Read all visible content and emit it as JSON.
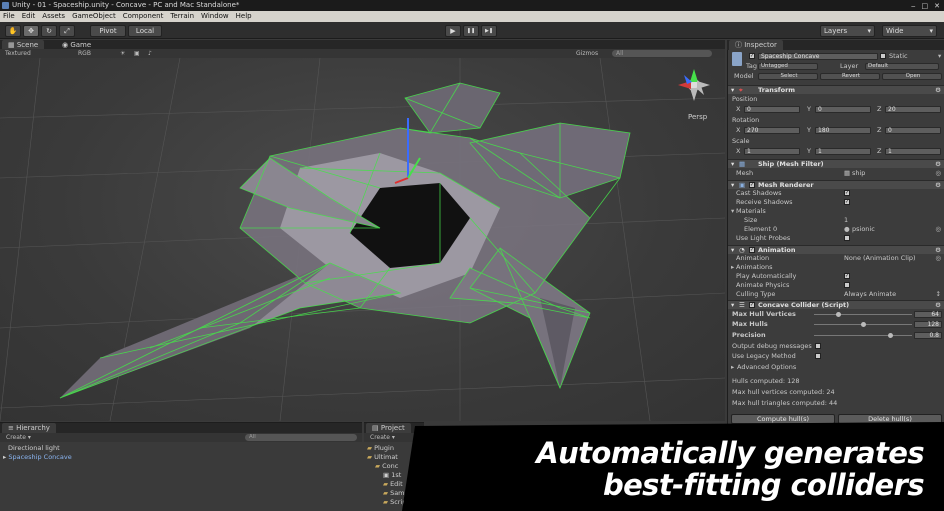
{
  "window": {
    "title": "Unity - 01 - Spaceship.unity - Concave - PC and Mac Standalone*"
  },
  "menu": [
    "File",
    "Edit",
    "Assets",
    "GameObject",
    "Component",
    "Terrain",
    "Window",
    "Help"
  ],
  "toolbar": {
    "pivot": "Pivot",
    "local": "Local",
    "play": "▶",
    "pause": "❚❚",
    "step": "▶❚",
    "layers": "Layers",
    "layout": "Wide"
  },
  "tabs": {
    "scene": "Scene",
    "game": "Game",
    "inspector": "Inspector",
    "hierarchy": "Hierarchy",
    "project": "Project"
  },
  "scene_bar": {
    "mode": "Textured",
    "channel": "RGB",
    "gizmos": "Gizmos",
    "search": "All"
  },
  "scene": {
    "projection": "Persp",
    "accent_color": "#46e04a"
  },
  "inspector": {
    "object_name": "Spaceship Concave",
    "static_label": "Static",
    "tag_label": "Tag",
    "tag_value": "Untagged",
    "layer_label": "Layer",
    "layer_value": "Default",
    "model_label": "Model",
    "model_buttons": [
      "Select",
      "Revert",
      "Open"
    ],
    "transform": {
      "title": "Transform",
      "position_label": "Position",
      "position": {
        "x": "0",
        "y": "0",
        "z": "20"
      },
      "rotation_label": "Rotation",
      "rotation": {
        "x": "270",
        "y": "180",
        "z": "0"
      },
      "scale_label": "Scale",
      "scale": {
        "x": "1",
        "y": "1",
        "z": "1"
      }
    },
    "mesh_filter": {
      "title": "Ship (Mesh Filter)",
      "mesh_label": "Mesh",
      "mesh_value": "ship"
    },
    "mesh_renderer": {
      "title": "Mesh Renderer",
      "cast_shadows": "Cast Shadows",
      "receive_shadows": "Receive Shadows",
      "materials": "Materials",
      "size_label": "Size",
      "size_value": "1",
      "element0_label": "Element 0",
      "element0_value": "psionic",
      "light_probes": "Use Light Probes"
    },
    "animation": {
      "title": "Animation",
      "anim_label": "Animation",
      "anim_value": "None (Animation Clip)",
      "animations": "Animations",
      "play_auto": "Play Automatically",
      "animate_physics": "Animate Physics",
      "culling_label": "Culling Type",
      "culling_value": "Always Animate"
    },
    "concave": {
      "title": "Concave Collider (Script)",
      "max_hull_vertices_label": "Max Hull Vertices",
      "max_hull_vertices": "64",
      "max_hulls_label": "Max Hulls",
      "max_hulls": "128",
      "precision_label": "Precision",
      "precision": "0.8",
      "output_debug": "Output debug messages",
      "legacy": "Use Legacy Method",
      "advanced": "Advanced Options",
      "hulls_computed": "Hulls computed: 128",
      "max_hull_vertices_computed": "Max hull vertices computed: 24",
      "max_hull_triangles_computed": "Max hull triangles computed: 44",
      "compute_button": "Compute hull(s)",
      "delete_button": "Delete hull(s)"
    }
  },
  "hierarchy": {
    "create": "Create ▾",
    "search": "All",
    "items": [
      "Directional light",
      "Spaceship Concave"
    ]
  },
  "project": {
    "create": "Create ▾",
    "items": [
      "Plugin",
      "Ultimat",
      "Conc",
      "1st",
      "Edit",
      "Sam",
      "Script"
    ]
  },
  "banner": {
    "line1": "Automatically generates",
    "line2": "best-fitting colliders"
  }
}
